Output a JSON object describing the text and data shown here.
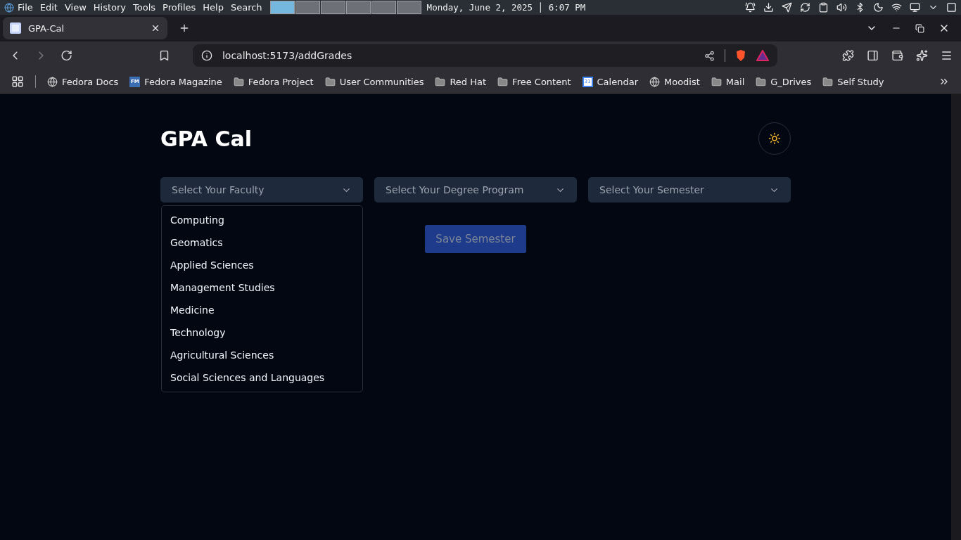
{
  "system_bar": {
    "menu": [
      "File",
      "Edit",
      "View",
      "History",
      "Tools",
      "Profiles",
      "Help",
      "Search"
    ],
    "workspaces": [
      {
        "selected": true
      },
      {
        "selected": false
      },
      {
        "selected": false
      },
      {
        "selected": false
      },
      {
        "selected": false
      },
      {
        "selected": false
      }
    ],
    "clock": "Monday, June 2, 2025 │ 6:07 PM"
  },
  "browser": {
    "tabs": [
      {
        "title": "GPA-Cal",
        "selected": true
      }
    ],
    "address": "localhost:5173/addGrades",
    "bookmarks": [
      {
        "label": "Fedora Docs",
        "kind": "globe"
      },
      {
        "label": "Fedora Magazine",
        "kind": "fm",
        "badge": "FM"
      },
      {
        "label": "Fedora Project",
        "kind": "folder"
      },
      {
        "label": "User Communities",
        "kind": "folder"
      },
      {
        "label": "Red Hat",
        "kind": "folder"
      },
      {
        "label": "Free Content",
        "kind": "folder"
      },
      {
        "label": "Calendar",
        "kind": "calendar",
        "badge": "31"
      },
      {
        "label": "Moodist",
        "kind": "globe"
      },
      {
        "label": "Mail",
        "kind": "folder"
      },
      {
        "label": "G_Drives",
        "kind": "folder"
      },
      {
        "label": "Self Study",
        "kind": "folder"
      }
    ]
  },
  "page": {
    "title": "GPA Cal",
    "selects": [
      {
        "placeholder": "Select Your Faculty",
        "open_options": [
          "Computing",
          "Geomatics",
          "Applied Sciences",
          "Management Studies",
          "Medicine",
          "Technology",
          "Agricultural Sciences",
          "Social Sciences and Languages"
        ]
      },
      {
        "placeholder": "Select Your Degree Program"
      },
      {
        "placeholder": "Select Your Semester"
      }
    ],
    "save_button": {
      "label": "Save Semester",
      "disabled": true
    }
  }
}
